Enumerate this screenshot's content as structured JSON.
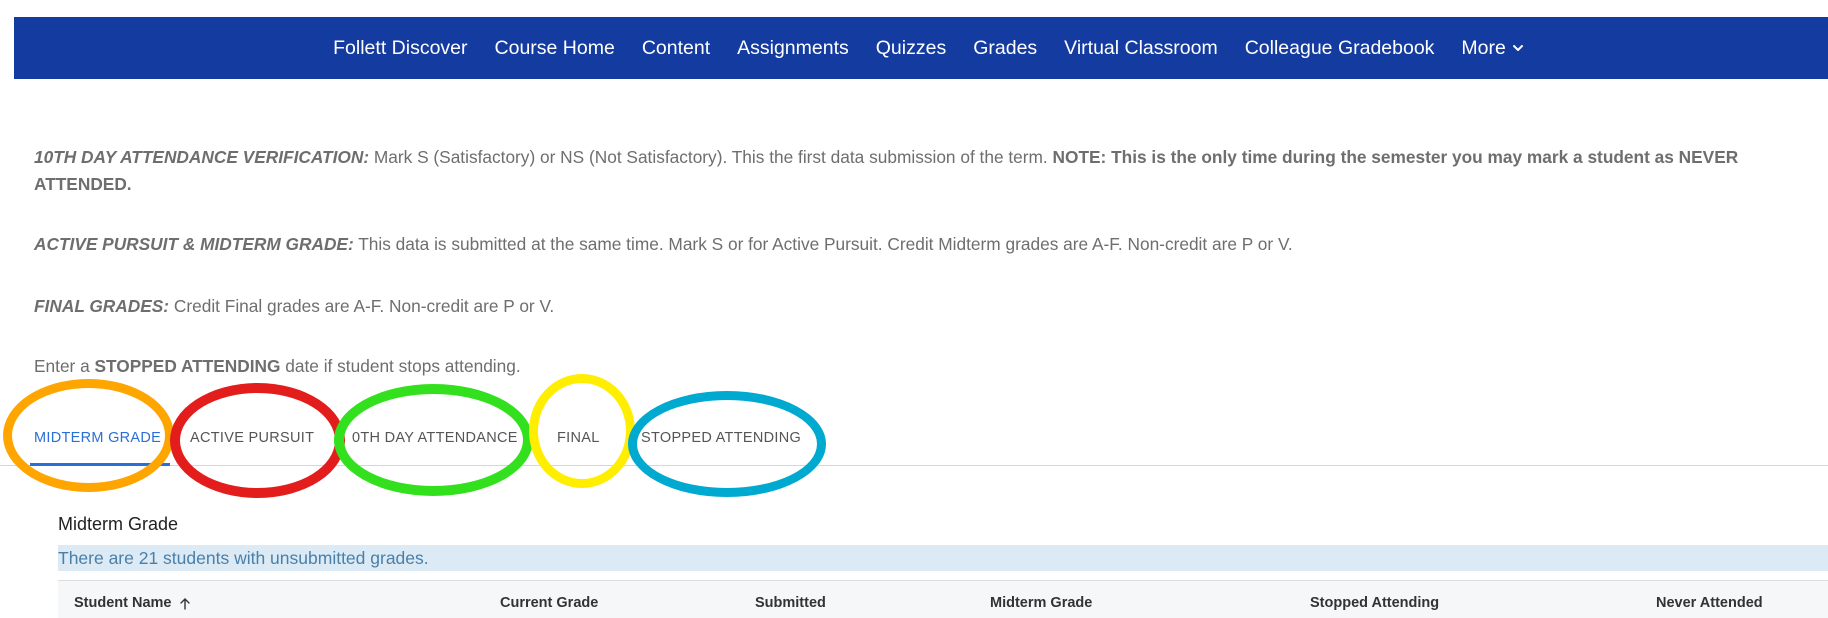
{
  "nav": {
    "items": [
      {
        "label": "Follett Discover"
      },
      {
        "label": "Course Home"
      },
      {
        "label": "Content"
      },
      {
        "label": "Assignments"
      },
      {
        "label": "Quizzes"
      },
      {
        "label": "Grades"
      },
      {
        "label": "Virtual Classroom"
      },
      {
        "label": "Colleague Gradebook"
      },
      {
        "label": "More"
      }
    ],
    "more_icon": "chevron-down-icon",
    "colors": {
      "bar": "#133ba0",
      "text": "#ffffff"
    }
  },
  "instructions": {
    "p1": {
      "label": "10TH DAY ATTENDANCE VERIFICATION:",
      "text": " Mark S (Satisfactory) or NS (Not Satisfactory). This the first data submission of the term. ",
      "note": "NOTE: This is the only time during the semester you may mark a student as NEVER ATTENDED."
    },
    "p2": {
      "label": "ACTIVE PURSUIT & MIDTERM GRADE:",
      "text": " This data is submitted at the same time. Mark S or for Active Pursuit. Credit Midterm grades are A-F. Non-credit are P or V."
    },
    "p3": {
      "label": "FINAL GRADES:",
      "text": " Credit Final grades are A-F. Non-credit are P or V."
    },
    "p4": {
      "pre": "Enter a ",
      "strong": "STOPPED ATTENDING",
      "post": " date if student stops attending."
    }
  },
  "tabs": [
    {
      "label": "MIDTERM GRADE",
      "active": true
    },
    {
      "label": "ACTIVE PURSUIT",
      "active": false
    },
    {
      "label": "0TH DAY ATTENDANCE",
      "active": false
    },
    {
      "label": "FINAL",
      "active": false
    },
    {
      "label": "STOPPED ATTENDING",
      "active": false
    }
  ],
  "annotations": {
    "colors": [
      "#ffa500",
      "#e31c1c",
      "#33e01e",
      "#ffee00",
      "#00a9cf"
    ]
  },
  "grade_section": {
    "title": "Midterm Grade",
    "alert": "There are 21 students with unsubmitted grades.",
    "columns": [
      {
        "label": "Student Name",
        "icon": "sort-ascending-icon"
      },
      {
        "label": "Current Grade"
      },
      {
        "label": "Submitted"
      },
      {
        "label": "Midterm Grade"
      },
      {
        "label": "Stopped Attending"
      },
      {
        "label": "Never Attended"
      }
    ]
  }
}
